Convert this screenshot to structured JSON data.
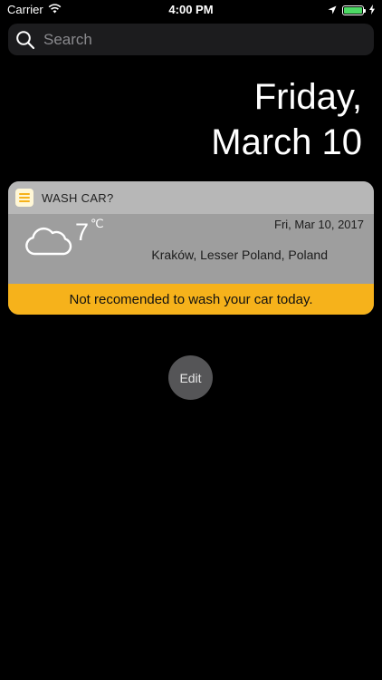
{
  "status_bar": {
    "carrier": "Carrier",
    "time": "4:00 PM",
    "battery_level": 1.0,
    "icons": [
      "wifi-icon",
      "location-arrow-icon",
      "battery-icon",
      "charging-bolt-icon"
    ]
  },
  "search": {
    "placeholder": "Search",
    "icon": "search-icon"
  },
  "date": {
    "weekday": "Friday,",
    "day": "March 10"
  },
  "widget": {
    "app_name": "WASH CAR?",
    "app_icon": "wash-car-app-icon",
    "weather_icon": "cloud-icon",
    "temperature": "7",
    "temperature_unit": "℃",
    "date": "Fri, Mar 10, 2017",
    "location": "Kraków, Lesser Poland, Poland",
    "recommendation": "Not recomended to wash your car today."
  },
  "edit_button": {
    "label": "Edit"
  },
  "colors": {
    "background": "#000000",
    "widget_header": "#b7b7b7",
    "widget_body": "#9e9e9e",
    "warning_bar": "#f6b21b",
    "battery": "#4cd964"
  }
}
